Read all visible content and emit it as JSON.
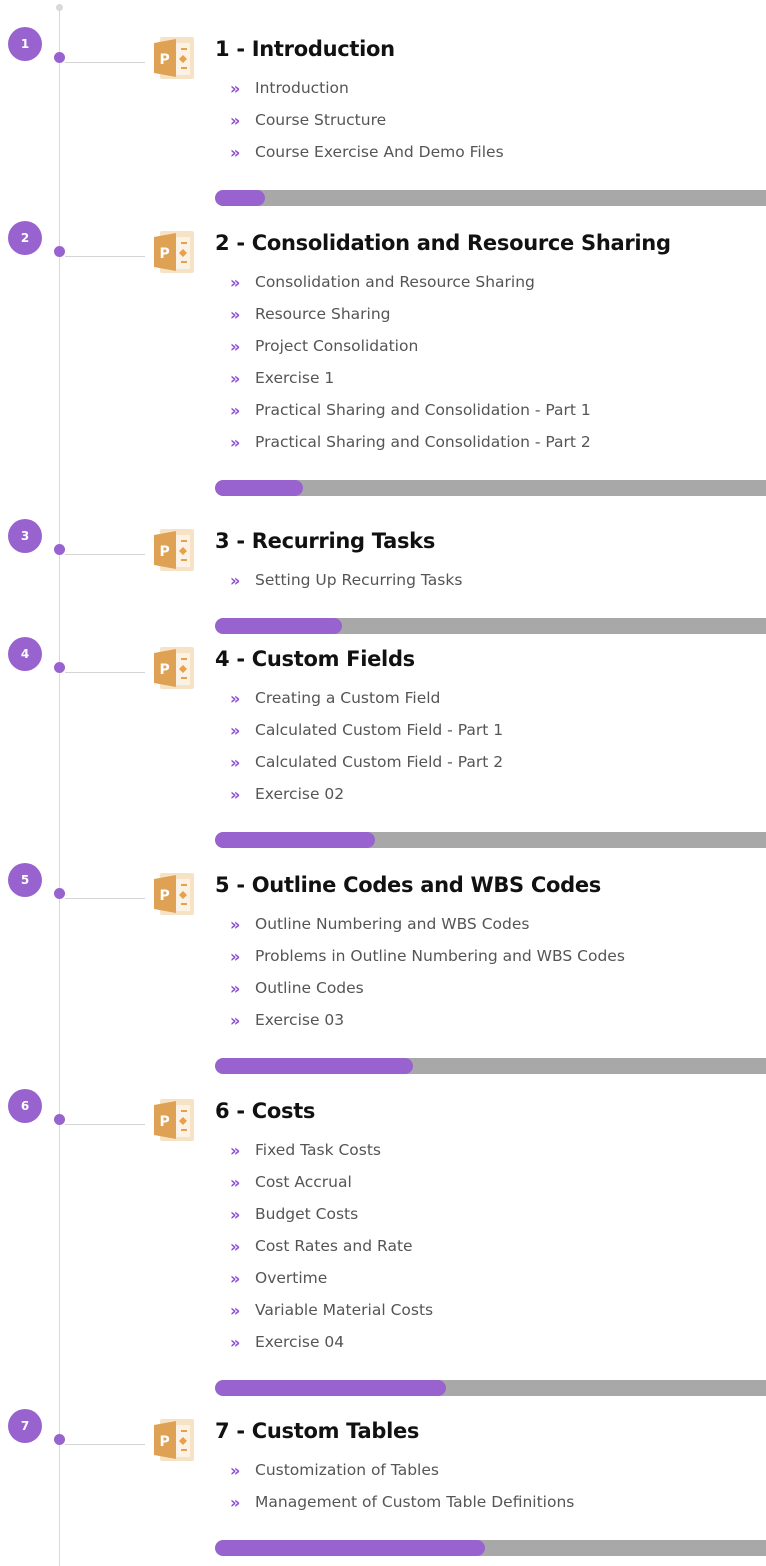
{
  "accent_color": "#9963cf",
  "bullet_glyph": "»",
  "module_icon": "project-file-icon",
  "modules": [
    {
      "number": "1",
      "title": "1 - Introduction",
      "progress": 0.09,
      "lessons": [
        "Introduction",
        "Course Structure",
        "Course Exercise And Demo Files"
      ]
    },
    {
      "number": "2",
      "title": "2 - Consolidation and Resource Sharing",
      "progress": 0.16,
      "lessons": [
        "Consolidation and Resource Sharing",
        "Resource Sharing",
        "Project Consolidation",
        "Exercise 1",
        "Practical Sharing and Consolidation - Part 1",
        "Practical Sharing and Consolidation - Part 2"
      ]
    },
    {
      "number": "3",
      "title": "3 - Recurring Tasks",
      "progress": 0.23,
      "lessons": [
        "Setting Up Recurring Tasks"
      ]
    },
    {
      "number": "4",
      "title": "4 - Custom Fields",
      "progress": 0.29,
      "lessons": [
        "Creating a Custom Field",
        "Calculated Custom Field - Part 1",
        "Calculated Custom Field - Part 2",
        "Exercise 02"
      ]
    },
    {
      "number": "5",
      "title": "5 - Outline Codes and WBS Codes",
      "progress": 0.36,
      "lessons": [
        "Outline Numbering and WBS Codes",
        "Problems in Outline Numbering and WBS Codes",
        "Outline Codes",
        "Exercise 03"
      ]
    },
    {
      "number": "6",
      "title": "6 - Costs",
      "progress": 0.42,
      "lessons": [
        "Fixed Task Costs",
        "Cost Accrual",
        "Budget Costs",
        "Cost Rates and Rate",
        "Overtime",
        "Variable Material Costs",
        "Exercise 04"
      ]
    },
    {
      "number": "7",
      "title": "7 - Custom Tables",
      "progress": 0.49,
      "lessons": [
        "Customization of Tables",
        "Management of Custom Table Definitions"
      ]
    }
  ]
}
